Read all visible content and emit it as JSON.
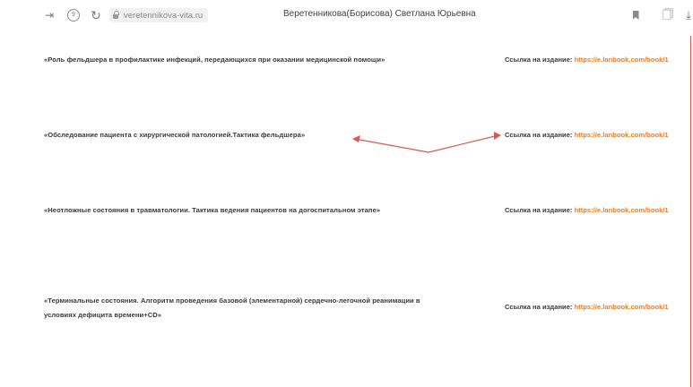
{
  "browser": {
    "url": "veretennikova-vita.ru",
    "tab_title": "Веретенникова(Борисова) Светлана Юрьевна",
    "icons": {
      "forward": "forward-icon",
      "extension": "extension-icon",
      "reload": "reload-icon",
      "lock": "lock-icon",
      "bookmark": "bookmark-icon",
      "reader": "reader-mode-icon",
      "download": "download-icon"
    }
  },
  "rows": [
    {
      "title": "«Роль фельдшера в профилактике инфекций, передающихся при оказании медицинской помощи»",
      "link_label": "Ссылка на издание:",
      "link_url": "https://e.lanbook.com/book/1"
    },
    {
      "title": "«Обследование пациента с хирургической патологией.Тактика фельдшера»",
      "link_label": "Ссылка на издание:",
      "link_url": "https://e.lanbook.com/book/1"
    },
    {
      "title": "«Неотложные состояния в травматологии. Тактика ведения пациентов на догоспитальном этапе»",
      "link_label": "Ссылка на издание:",
      "link_url": "https://e.lanbook.com/book/1"
    },
    {
      "title_line1": "«Терминальные состояния. Алгоритм проведения базовой (элементарной) сердечно-легочной реанимации в",
      "title_line2": "условиях дефицита времени+CD»",
      "link_label": "Ссылка на издание:",
      "link_url": "https://e.lanbook.com/book/1"
    }
  ],
  "colors": {
    "link": "#f47a1f",
    "annotation": "#e0584c"
  }
}
